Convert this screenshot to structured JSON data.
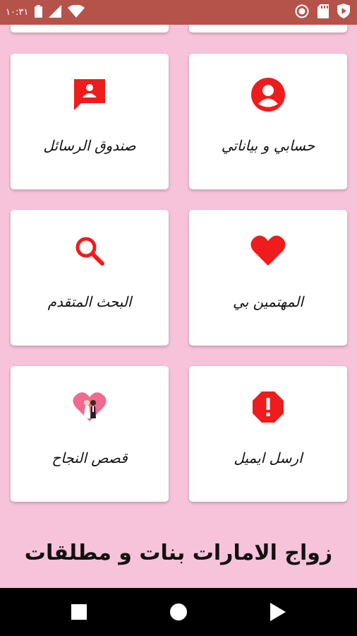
{
  "status_bar": {
    "time": "١٠:٣١",
    "left_icons": [
      "battery-icon",
      "signal-icon",
      "wifi-icon"
    ],
    "right_icons": [
      "record-icon",
      "sd-card-icon",
      "play-shield-icon"
    ]
  },
  "menu": {
    "items": [
      {
        "id": "my-account",
        "label": "حسابي و بياناتي",
        "icon": "account-circle-icon"
      },
      {
        "id": "inbox",
        "label": "صندوق الرسائل",
        "icon": "message-contact-icon"
      },
      {
        "id": "interested",
        "label": "المهتمين بي",
        "icon": "heart-icon"
      },
      {
        "id": "advanced-search",
        "label": "البحث المتقدم",
        "icon": "search-icon"
      },
      {
        "id": "send-email",
        "label": "ارسل ايميل",
        "icon": "alert-octagon-icon"
      },
      {
        "id": "success-stories",
        "label": "قصص النجاح",
        "icon": "couple-heart-icon"
      }
    ]
  },
  "app_title": "زواج الامارات بنات و مطلقات",
  "nav_bar": {
    "buttons": [
      "recents-square-icon",
      "home-circle-icon",
      "back-triangle-icon"
    ]
  },
  "colors": {
    "background": "#f7c3da",
    "status_bar": "#b5534a",
    "accent": "#ee1c1c",
    "card": "#ffffff",
    "nav_bar": "#000000"
  }
}
